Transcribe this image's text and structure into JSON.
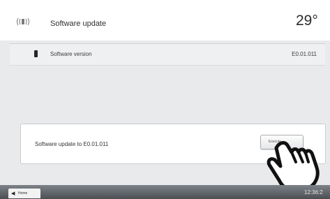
{
  "header": {
    "icon": "vibration-wave-icon",
    "title": "Software update",
    "temperature": "29°"
  },
  "version_row": {
    "icon": "device-icon",
    "label": "Software version",
    "value": "E0.01.011"
  },
  "update_panel": {
    "label": "Software update to  E0.01.011",
    "button_label": "Execute"
  },
  "footer": {
    "home_label": "Home",
    "home_icon": "left-arrow-icon",
    "time": "12:36:2"
  },
  "overlay": {
    "icon": "tap-hand-icon"
  },
  "colors": {
    "content_bg": "#e9eaec",
    "footer_bg": "#5e6267"
  }
}
